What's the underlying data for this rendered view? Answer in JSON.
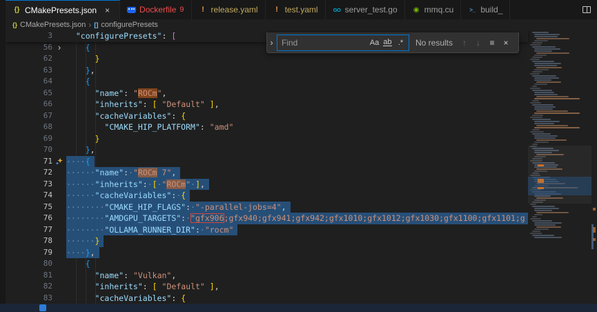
{
  "app": "Visual Studio Code",
  "colors": {
    "accent": "#0078d4",
    "selection": "#264f78",
    "match_highlight": "#e26a1a",
    "match_border": "#d6463c",
    "error": "#f14c4c",
    "warning": "#e8984a",
    "tab_bar_bg": "#181818",
    "editor_bg": "#1f1f1f",
    "status_bar_bg": "#1b2738"
  },
  "icons": {
    "json": "{}",
    "warning": "!",
    "go": "GO",
    "cuda": "◉",
    "shell": ">_",
    "docker": "",
    "close": "×",
    "chevron": "›",
    "fold_collapsed": "›",
    "breadcrumb_sep": "›",
    "array": "[]",
    "prev": "↑",
    "next": "↓",
    "in_selection": "≡"
  },
  "tabs": [
    {
      "label": "CMakePresets.json",
      "icon": "json",
      "active": true
    },
    {
      "label": "Dockerfile",
      "icon": "docker",
      "badge": "9",
      "label_color": "#f14c4c"
    },
    {
      "label": "release.yaml",
      "icon": "warning",
      "label_color": "#c3aa5e"
    },
    {
      "label": "test.yaml",
      "icon": "warning",
      "label_color": "#c3aa5e"
    },
    {
      "label": "server_test.go",
      "icon": "go"
    },
    {
      "label": "mmq.cu",
      "icon": "cuda"
    },
    {
      "label": "build_",
      "icon": "shell"
    }
  ],
  "breadcrumb": {
    "file": "CMakePresets.json",
    "symbol": "configurePresets"
  },
  "find": {
    "placeholder": "Find",
    "value": "",
    "match_case": "Aa",
    "whole_word": "ab",
    "regex": ".*",
    "status": "No results"
  },
  "statusbar": {
    "icon": "remote-indicator"
  },
  "editor": {
    "sticky_line": {
      "n": 3,
      "t": [
        [
          "ws",
          "  "
        ],
        [
          "key",
          "\"configurePresets\""
        ],
        [
          "pun",
          ":"
        ],
        [
          "ws",
          " "
        ],
        [
          "b2",
          "["
        ]
      ]
    },
    "lines": [
      {
        "n": 56,
        "fold": true,
        "t": [
          [
            "ws",
            "    "
          ],
          [
            "b3",
            "{"
          ]
        ]
      },
      {
        "n": 62,
        "t": [
          [
            "ws",
            "      "
          ],
          [
            "b1",
            "}"
          ]
        ]
      },
      {
        "n": 63,
        "t": [
          [
            "ws",
            "    "
          ],
          [
            "b3",
            "}"
          ],
          [
            "pun",
            ","
          ]
        ]
      },
      {
        "n": 64,
        "t": [
          [
            "ws",
            "    "
          ],
          [
            "b3",
            "{"
          ]
        ]
      },
      {
        "n": 65,
        "t": [
          [
            "ws",
            "      "
          ],
          [
            "key",
            "\"name\""
          ],
          [
            "pun",
            ":"
          ],
          [
            "ws",
            " "
          ],
          [
            "str",
            "\""
          ],
          [
            "strhl",
            "ROCm"
          ],
          [
            "str",
            "\""
          ],
          [
            "pun",
            ","
          ]
        ]
      },
      {
        "n": 66,
        "t": [
          [
            "ws",
            "      "
          ],
          [
            "key",
            "\"inherits\""
          ],
          [
            "pun",
            ":"
          ],
          [
            "ws",
            " "
          ],
          [
            "b1",
            "["
          ],
          [
            "ws",
            " "
          ],
          [
            "str",
            "\"Default\""
          ],
          [
            "ws",
            " "
          ],
          [
            "b1",
            "]"
          ],
          [
            "pun",
            ","
          ]
        ]
      },
      {
        "n": 67,
        "t": [
          [
            "ws",
            "      "
          ],
          [
            "key",
            "\"cacheVariables\""
          ],
          [
            "pun",
            ":"
          ],
          [
            "ws",
            " "
          ],
          [
            "b1",
            "{"
          ]
        ]
      },
      {
        "n": 68,
        "t": [
          [
            "ws",
            "        "
          ],
          [
            "key",
            "\"CMAKE_HIP_PLATFORM\""
          ],
          [
            "pun",
            ":"
          ],
          [
            "ws",
            " "
          ],
          [
            "str",
            "\"amd\""
          ]
        ]
      },
      {
        "n": 69,
        "t": [
          [
            "ws",
            "      "
          ],
          [
            "b1",
            "}"
          ]
        ]
      },
      {
        "n": 70,
        "t": [
          [
            "ws",
            "    "
          ],
          [
            "b3",
            "}"
          ],
          [
            "pun",
            ","
          ]
        ]
      },
      {
        "n": 71,
        "sel": true,
        "sparkle": true,
        "t": [
          [
            "ws",
            "    "
          ],
          [
            "b3",
            "{"
          ]
        ]
      },
      {
        "n": 72,
        "sel": true,
        "t": [
          [
            "ws",
            "      "
          ],
          [
            "key",
            "\"name\""
          ],
          [
            "pun",
            ":"
          ],
          [
            "ws",
            " "
          ],
          [
            "str",
            "\""
          ],
          [
            "strhl",
            "ROCm"
          ],
          [
            "str",
            " 7\""
          ],
          [
            "pun",
            ","
          ]
        ]
      },
      {
        "n": 73,
        "sel": true,
        "t": [
          [
            "ws",
            "      "
          ],
          [
            "key",
            "\"inherits\""
          ],
          [
            "pun",
            ":"
          ],
          [
            "ws",
            " "
          ],
          [
            "b1",
            "["
          ],
          [
            "ws",
            " "
          ],
          [
            "str",
            "\""
          ],
          [
            "strhl",
            "ROCm"
          ],
          [
            "str",
            "\""
          ],
          [
            "ws",
            " "
          ],
          [
            "b1",
            "]"
          ],
          [
            "pun",
            ","
          ]
        ]
      },
      {
        "n": 74,
        "sel": true,
        "t": [
          [
            "ws",
            "      "
          ],
          [
            "key",
            "\"cacheVariables\""
          ],
          [
            "pun",
            ":"
          ],
          [
            "ws",
            " "
          ],
          [
            "b1",
            "{"
          ]
        ]
      },
      {
        "n": 75,
        "sel": true,
        "t": [
          [
            "ws",
            "        "
          ],
          [
            "key",
            "\"CMAKE_HIP_FLAGS\""
          ],
          [
            "pun",
            ":"
          ],
          [
            "ws",
            " "
          ],
          [
            "str",
            "\"-parallel-jobs=4\""
          ],
          [
            "pun",
            ","
          ]
        ]
      },
      {
        "n": 76,
        "sel": true,
        "t": [
          [
            "ws",
            "        "
          ],
          [
            "key",
            "\"AMDGPU_TARGETS\""
          ],
          [
            "pun",
            ":"
          ],
          [
            "ws",
            " "
          ],
          [
            "strbox",
            "\"gfx906"
          ],
          [
            "str",
            ";gfx940;gfx941;gfx942;gfx1010;gfx1012;gfx1030;gfx1100;gfx1101;g"
          ]
        ]
      },
      {
        "n": 77,
        "sel": true,
        "t": [
          [
            "ws",
            "        "
          ],
          [
            "key",
            "\"OLLAMA_RUNNER_DIR\""
          ],
          [
            "pun",
            ":"
          ],
          [
            "ws",
            " "
          ],
          [
            "str",
            "\"rocm\""
          ]
        ]
      },
      {
        "n": 78,
        "sel": true,
        "t": [
          [
            "ws",
            "      "
          ],
          [
            "b1",
            "}"
          ]
        ]
      },
      {
        "n": 79,
        "sel": true,
        "t": [
          [
            "ws",
            "    "
          ],
          [
            "b3",
            "}"
          ],
          [
            "pun",
            ","
          ]
        ]
      },
      {
        "n": 80,
        "t": [
          [
            "ws",
            "    "
          ],
          [
            "b3",
            "{"
          ]
        ]
      },
      {
        "n": 81,
        "t": [
          [
            "ws",
            "      "
          ],
          [
            "key",
            "\"name\""
          ],
          [
            "pun",
            ":"
          ],
          [
            "ws",
            " "
          ],
          [
            "str",
            "\"Vulkan\""
          ],
          [
            "pun",
            ","
          ]
        ]
      },
      {
        "n": 82,
        "t": [
          [
            "ws",
            "      "
          ],
          [
            "key",
            "\"inherits\""
          ],
          [
            "pun",
            ":"
          ],
          [
            "ws",
            " "
          ],
          [
            "b1",
            "["
          ],
          [
            "ws",
            " "
          ],
          [
            "str",
            "\"Default\""
          ],
          [
            "ws",
            " "
          ],
          [
            "b1",
            "]"
          ],
          [
            "pun",
            ","
          ]
        ]
      },
      {
        "n": 83,
        "t": [
          [
            "ws",
            "      "
          ],
          [
            "key",
            "\"cacheVariables\""
          ],
          [
            "pun",
            ":"
          ],
          [
            "ws",
            " "
          ],
          [
            "b1",
            "{"
          ]
        ]
      }
    ],
    "minimap": {
      "total_lines": 100,
      "long_lines": [
        33,
        40,
        47,
        76
      ],
      "match_lines": [
        65,
        72,
        73,
        76
      ],
      "selection_lines": [
        71,
        79
      ],
      "visible_lines": [
        56,
        83
      ]
    }
  }
}
